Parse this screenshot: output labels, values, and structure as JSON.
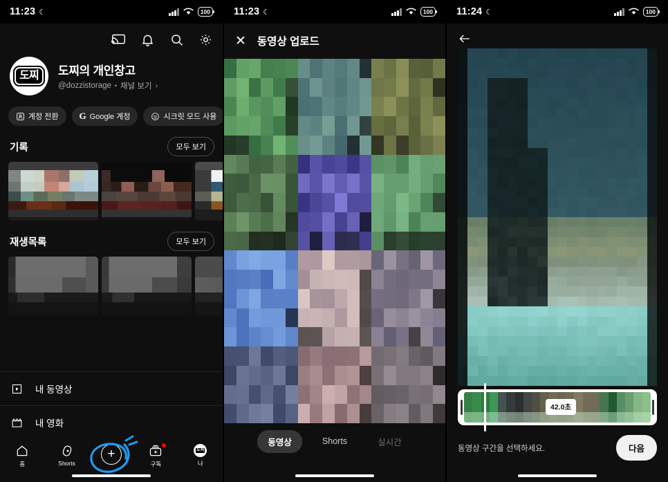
{
  "panels": [
    {
      "id": "account-panel",
      "status": {
        "time": "11:23",
        "moon": "☾",
        "battery": "100"
      },
      "top_icons": [
        "cast-icon",
        "notifications-icon",
        "search-icon",
        "settings-icon"
      ],
      "profile": {
        "avatar_text": "도찌",
        "name": "도찌의 개인창고",
        "handle": "@dozzistorage",
        "separator": "•",
        "view_channel": "채널 보기",
        "chevron": "›"
      },
      "chips": [
        {
          "label": "계정 전환",
          "icon": "switch-account-icon"
        },
        {
          "label": "Google 계정",
          "icon": "google-g-icon"
        },
        {
          "label": "시크릿 모드 사용",
          "icon": "incognito-icon"
        }
      ],
      "sections": [
        {
          "title": "기록",
          "action": "모두 보기"
        },
        {
          "title": "재생목록",
          "action": "모두 보기"
        }
      ],
      "menu": [
        {
          "label": "내 동영상",
          "icon": "my-videos-icon"
        },
        {
          "label": "내 영화",
          "icon": "my-movies-icon"
        }
      ],
      "bottom_nav": [
        {
          "label": "홈",
          "icon": "home-icon"
        },
        {
          "label": "Shorts",
          "icon": "shorts-icon"
        },
        {
          "label": "",
          "icon": "create-plus-icon"
        },
        {
          "label": "구독",
          "icon": "subscriptions-icon",
          "badge": true
        },
        {
          "label": "나",
          "icon": "you-avatar-icon"
        }
      ],
      "annotation_color": "#2196f3"
    },
    {
      "id": "upload-picker-panel",
      "status": {
        "time": "11:23",
        "moon": "☾",
        "battery": "100"
      },
      "header": {
        "close_icon": "close-icon",
        "title": "동영상 업로드"
      },
      "tabs": [
        {
          "label": "동영상",
          "selected": true
        },
        {
          "label": "Shorts",
          "selected": false
        },
        {
          "label": "실시간",
          "selected": false,
          "disabled": true
        }
      ]
    },
    {
      "id": "trim-panel",
      "status": {
        "time": "11:24",
        "moon": "☾",
        "battery": "100"
      },
      "header": {
        "back_icon": "back-arrow-icon"
      },
      "trim": {
        "duration_label": "42.0초",
        "hint": "동영상 구간을 선택하세요.",
        "next_label": "다음"
      }
    }
  ]
}
